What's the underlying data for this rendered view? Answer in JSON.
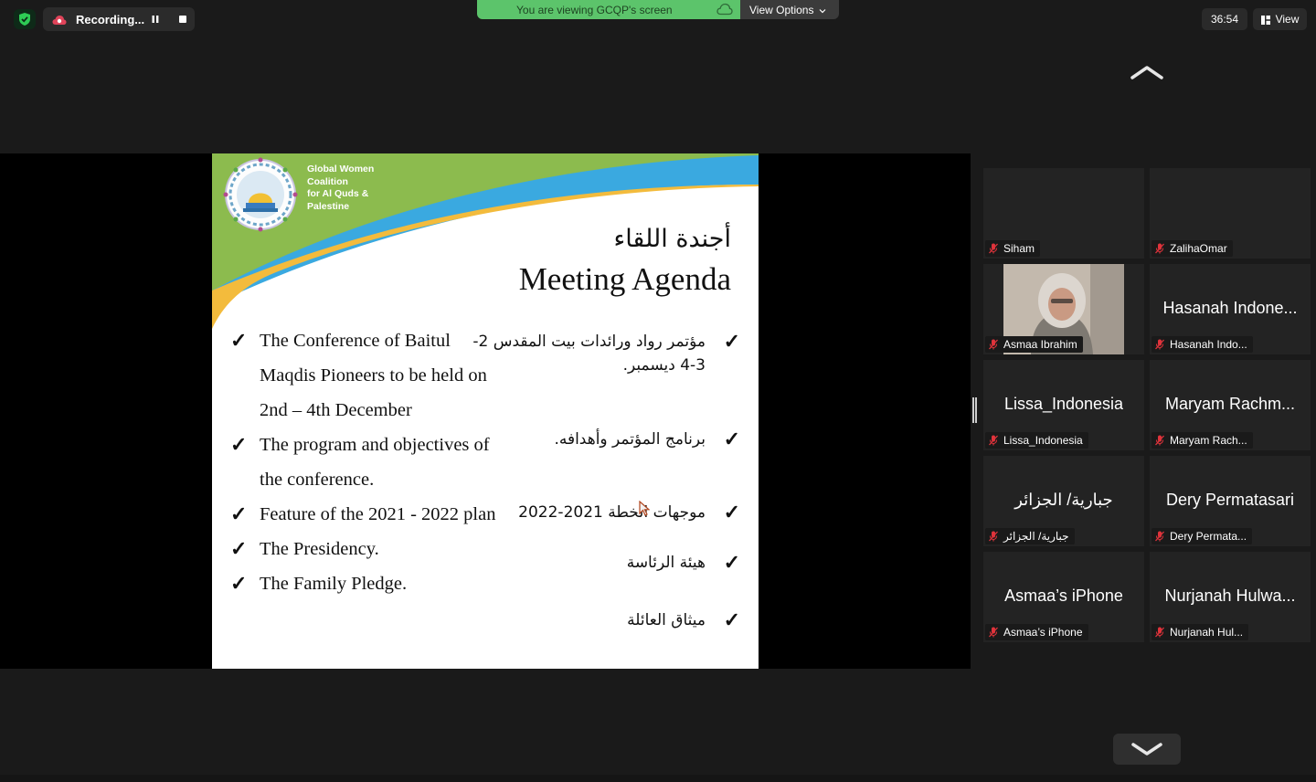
{
  "recording": {
    "label": "Recording..."
  },
  "banner": {
    "text": "You are viewing GCQP's screen",
    "color": "#5cc46b"
  },
  "view_options": {
    "label": "View Options"
  },
  "timer": {
    "value": "36:54"
  },
  "view_button": {
    "label": "View"
  },
  "slide": {
    "org_lines": [
      "Global Women",
      "Coalition",
      "for Al Quds &",
      "Palestine"
    ],
    "title_ar": "أجندة اللقاء",
    "title_en": "Meeting Agenda",
    "check": "✓",
    "items_en": [
      "The Conference of Baitul Maqdis  Pioneers to be held on 2nd – 4th December",
      "The program and objectives of the conference.",
      "Feature of the 2021 - 2022 plan",
      "The Presidency.",
      "The Family Pledge."
    ],
    "items_ar": [
      "مؤتمر رواد ورائدات بيت المقدس 2-3-4 ديسمبر.",
      "برنامج المؤتمر وأهدافه.",
      "موجهات الخطة 2021-2022",
      "هيئة الرئاسة",
      "ميثاق العائلة"
    ],
    "colors": {
      "green": "#8cbb4e",
      "blue": "#3aa9e0",
      "yellow": "#f3bb3c"
    }
  },
  "participants": [
    {
      "display": "",
      "name": "Siham",
      "muted": true
    },
    {
      "display": "",
      "name": "ZalihaOmar",
      "muted": true
    },
    {
      "display": "",
      "name": "Asmaa Ibrahim",
      "muted": true,
      "video": true
    },
    {
      "display": "Hasanah Indone...",
      "name": "Hasanah Indo...",
      "muted": true
    },
    {
      "display": "Lissa_Indonesia",
      "name": "Lissa_Indonesia",
      "muted": true
    },
    {
      "display": "Maryam Rachm...",
      "name": "Maryam Rach...",
      "muted": true
    },
    {
      "display": "جبارية/ الجزائر",
      "name": "جبارية/ الجزائر",
      "muted": true
    },
    {
      "display": "Dery Permatasari",
      "name": "Dery Permata...",
      "muted": true
    },
    {
      "display": "Asmaa’s iPhone",
      "name": "Asmaa’s iPhone",
      "muted": true
    },
    {
      "display": "Nurjanah Hulwa...",
      "name": "Nurjanah Hul...",
      "muted": true
    }
  ]
}
